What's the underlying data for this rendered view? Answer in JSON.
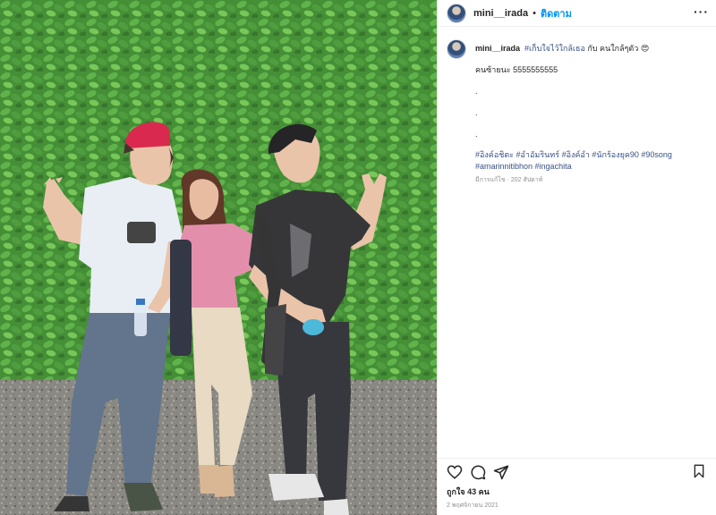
{
  "header": {
    "username": "mini__irada",
    "separator": "•",
    "follow_label": "ติดตาม",
    "more_label": "···"
  },
  "caption": {
    "username": "mini__irada",
    "hashtag_main": "#เก็บใจไว้ใกล้เธอ",
    "text_with": "กับ คนใกล้ๆตัว",
    "emoji": "😍",
    "line2": "คนซ้ายนะ 5555555555",
    "dots": [
      ".",
      ".",
      "."
    ],
    "tags_line1": "#อิงค์อชิตะ #อำอัมรินทร์ #อิงค์อำ #นักร้องยุค90 #90song",
    "tags_line2": "#amarinnitibhon #ingachita",
    "meta": "มีการแก้ไข · 202 สัปดาห์"
  },
  "footer": {
    "likes": "ถูกใจ 43 คน",
    "date": "2 พฤศจิกายน 2021"
  },
  "icons": {
    "like": "heart-icon",
    "comment": "comment-icon",
    "share": "share-icon",
    "save": "bookmark-icon"
  },
  "colors": {
    "link": "#385185",
    "follow": "#0095f6",
    "muted": "#8e8e8e"
  }
}
